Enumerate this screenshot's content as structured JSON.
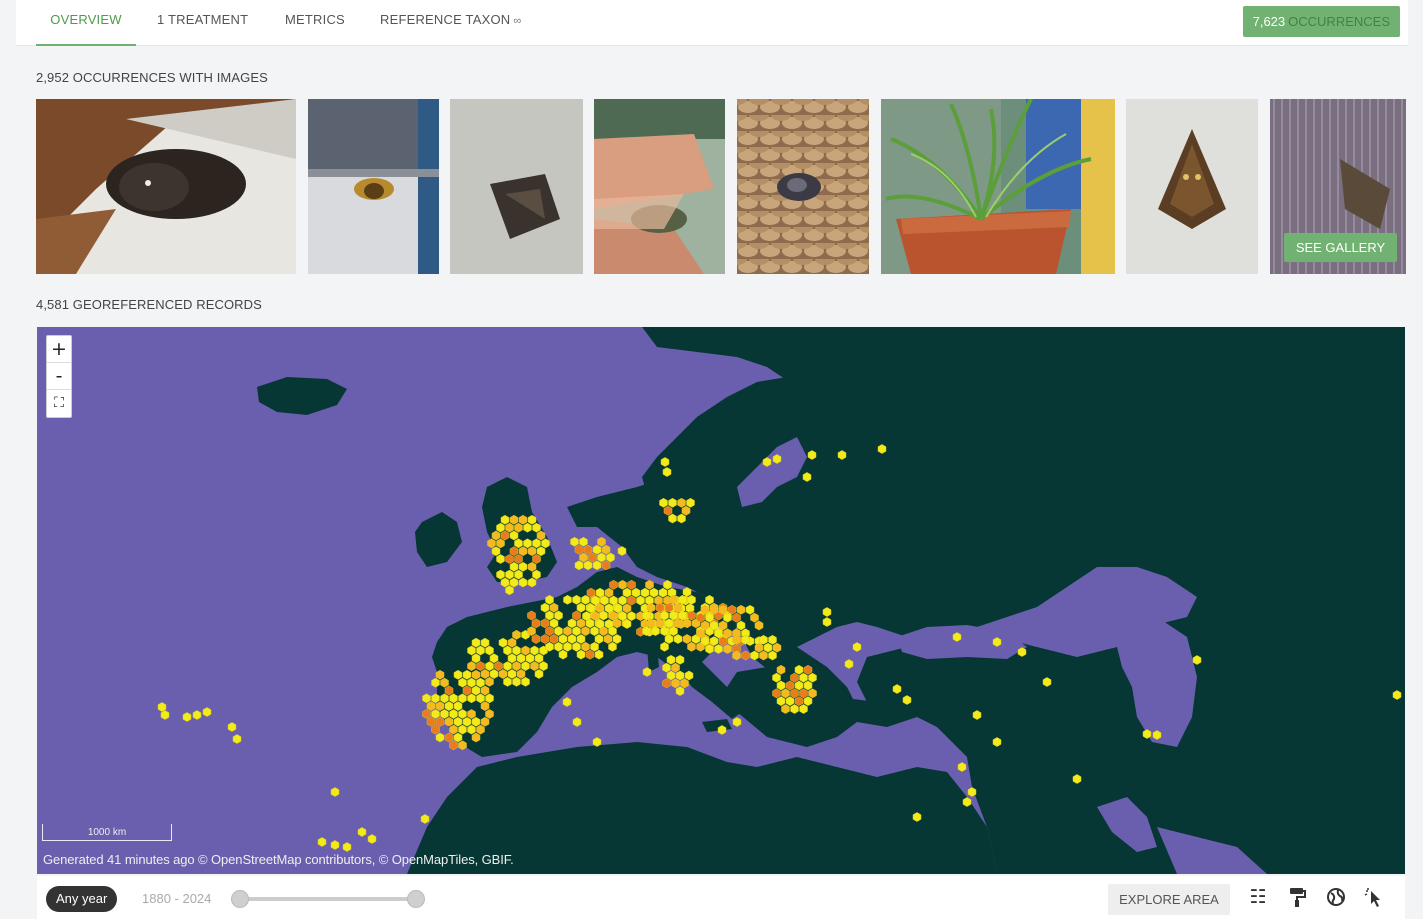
{
  "tabs": [
    {
      "label": "OVERVIEW",
      "active": true
    },
    {
      "label": "1 TREATMENT",
      "active": false
    },
    {
      "label": "METRICS",
      "active": false
    },
    {
      "label": "REFERENCE TAXON",
      "active": false,
      "icon": "link-icon"
    }
  ],
  "occurrences_button": {
    "count": "7,623",
    "label": "OCCURRENCES"
  },
  "images_section": {
    "title": "2,952 OCCURRENCES WITH IMAGES",
    "see_gallery": "SEE GALLERY",
    "thumbnails": [
      "moth on white cloth",
      "moth on window",
      "moth on wall",
      "moth on finger",
      "moth on wicker",
      "potted plant",
      "moth on white surface",
      "moth on textured wall"
    ]
  },
  "map_section": {
    "title": "4,581 GEOREFERENCED RECORDS",
    "zoom_in": "+",
    "zoom_out": "-",
    "scale_label": "1000 km",
    "attribution": "Generated 41 minutes ago © OpenStreetMap contributors, © OpenMapTiles, GBIF.",
    "colors": {
      "sea": "#6a5fae",
      "land": "#063734",
      "low": "#f2ea19",
      "mid": "#f7b920",
      "high": "#ec7a1e"
    }
  },
  "controls": {
    "year_filter": "Any year",
    "year_range": "1880 - 2024",
    "explore": "EXPLORE AREA",
    "icons": [
      "filter-sliders-icon",
      "paint-roller-icon",
      "globe-icon",
      "cursor-select-icon"
    ]
  }
}
